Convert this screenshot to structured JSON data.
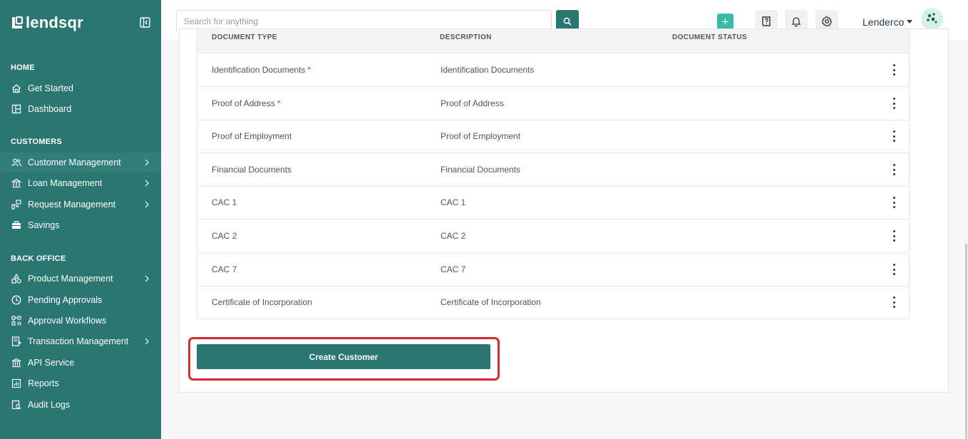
{
  "brand": {
    "name": "lendsqr"
  },
  "sidebar": {
    "sections": [
      {
        "title": "HOME"
      },
      {
        "title": "CUSTOMERS"
      },
      {
        "title": "BACK OFFICE"
      }
    ],
    "items": [
      {
        "label": "Get Started",
        "icon": "home-icon"
      },
      {
        "label": "Dashboard",
        "icon": "dashboard-icon"
      },
      {
        "label": "Customer Management",
        "icon": "users-icon",
        "active": true,
        "submenu": true
      },
      {
        "label": "Loan Management",
        "icon": "bank-icon",
        "submenu": true
      },
      {
        "label": "Request Management",
        "icon": "request-icon",
        "submenu": true
      },
      {
        "label": "Savings",
        "icon": "briefcase-icon"
      },
      {
        "label": "Product Management",
        "icon": "shapes-icon",
        "submenu": true
      },
      {
        "label": "Pending Approvals",
        "icon": "clock-icon"
      },
      {
        "label": "Approval Workflows",
        "icon": "workflow-icon"
      },
      {
        "label": "Transaction Management",
        "icon": "transaction-icon",
        "submenu": true
      },
      {
        "label": "API Service",
        "icon": "institution-icon"
      },
      {
        "label": "Reports",
        "icon": "report-icon"
      },
      {
        "label": "Audit Logs",
        "icon": "audit-icon"
      }
    ]
  },
  "topbar": {
    "search": {
      "placeholder": "Search for anything",
      "value": ""
    },
    "add_label": "+",
    "user": {
      "name": "Lenderco"
    }
  },
  "table": {
    "headers": [
      "DOCUMENT TYPE",
      "DESCRIPTION",
      "DOCUMENT STATUS"
    ],
    "rows": [
      {
        "type": "Identification Documents",
        "required": true,
        "description": "Identification Documents"
      },
      {
        "type": "Proof of Address",
        "required": true,
        "description": "Proof of Address"
      },
      {
        "type": "Proof of Employment",
        "required": false,
        "description": "Proof of Employment"
      },
      {
        "type": "Financial Documents",
        "required": false,
        "description": "Financial Documents"
      },
      {
        "type": "CAC 1",
        "required": false,
        "description": "CAC 1"
      },
      {
        "type": "CAC 2",
        "required": false,
        "description": "CAC 2"
      },
      {
        "type": "CAC 7",
        "required": false,
        "description": "CAC 7"
      },
      {
        "type": "Certificate of Incorporation",
        "required": false,
        "description": "Certificate of Incorporation"
      }
    ],
    "required_marker": "*"
  },
  "actions": {
    "create_customer_label": "Create Customer"
  },
  "colors": {
    "brand": "#2a7670",
    "accent": "#3bb9a8",
    "highlight": "#d72a2a",
    "required": "#e02424"
  }
}
